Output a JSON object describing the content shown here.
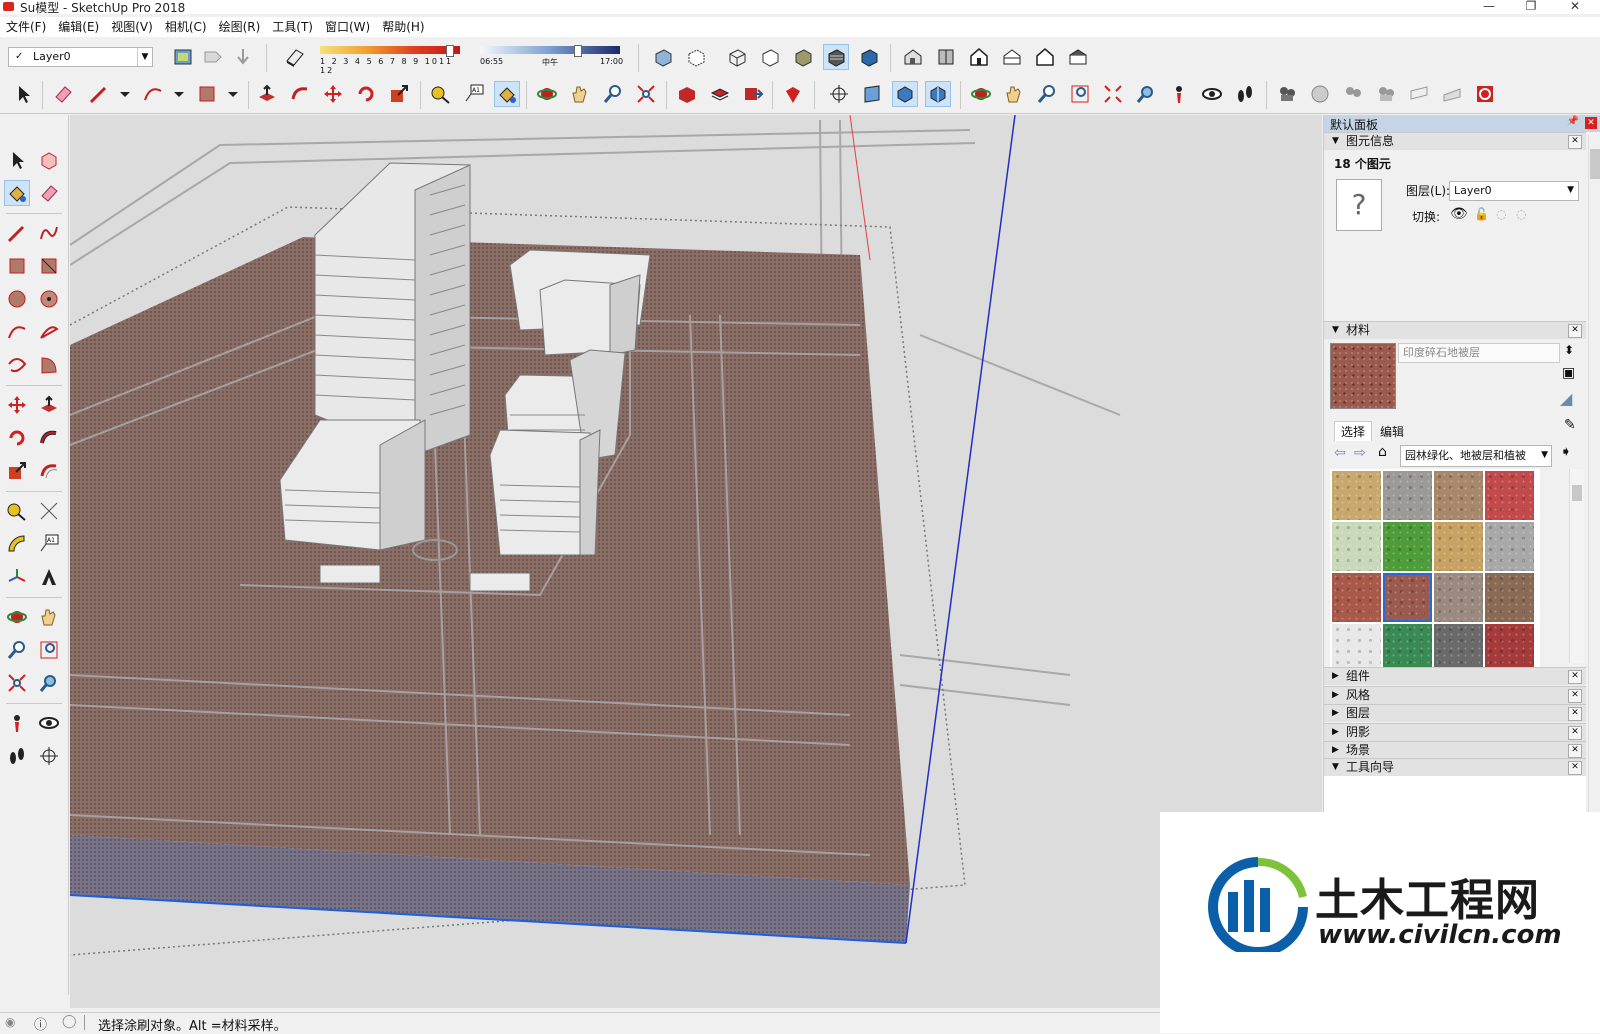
{
  "window": {
    "title": "Su模型 - SketchUp Pro 2018",
    "controls": {
      "minimize": "—",
      "maximize": "❐",
      "close": "✕"
    }
  },
  "menu": [
    "文件(F)",
    "编辑(E)",
    "视图(V)",
    "相机(C)",
    "绘图(R)",
    "工具(T)",
    "窗口(W)",
    "帮助(H)"
  ],
  "layer_toolbar": {
    "check": "✓",
    "current_layer": "Layer0"
  },
  "shadow_toolbar": {
    "months": [
      "1",
      "2",
      "3",
      "4",
      "5",
      "6",
      "7",
      "8",
      "9",
      "10",
      "11",
      "12"
    ],
    "time_start": "06:55",
    "time_mid": "中午",
    "time_end": "17:00"
  },
  "panel": {
    "title": "默认面板",
    "entity_info": {
      "header": "图元信息",
      "count": "18 个图元",
      "unknown_glyph": "?",
      "layer_label": "图层(L):",
      "layer_value": "Layer0",
      "toggle_label": "切换:"
    },
    "materials": {
      "header": "材料",
      "material_name": "印度碎石地被层",
      "tab_select": "选择",
      "tab_edit": "编辑",
      "library": "园林绿化、地被层和植被",
      "swatch_colors": [
        "#c9a86e",
        "#9b9a96",
        "#a8876a",
        "#c24a4a",
        "#c8d8b8",
        "#4e9c3a",
        "#c8a262",
        "#a8a8a8",
        "#a8594a",
        "#9a5a4e",
        "#9a8a80",
        "#8a6a54",
        "#e8e8e8",
        "#3a8a54",
        "#6a6a6a",
        "#a43a3a"
      ],
      "selected_index": 9
    },
    "collapsed_sections": [
      "组件",
      "风格",
      "图层",
      "阴影",
      "场景"
    ],
    "expanded_section": "工具向导"
  },
  "statusbar": {
    "message": "选择涂刷对象。Alt =材料采样。"
  },
  "watermark": {
    "brand": "土木工程网",
    "url": "www.civilcn.com"
  },
  "colors": {
    "ground": "#8a6c64",
    "building": "#ececec",
    "sky": "#dcdcdc",
    "accent": "#0b5fa8"
  }
}
